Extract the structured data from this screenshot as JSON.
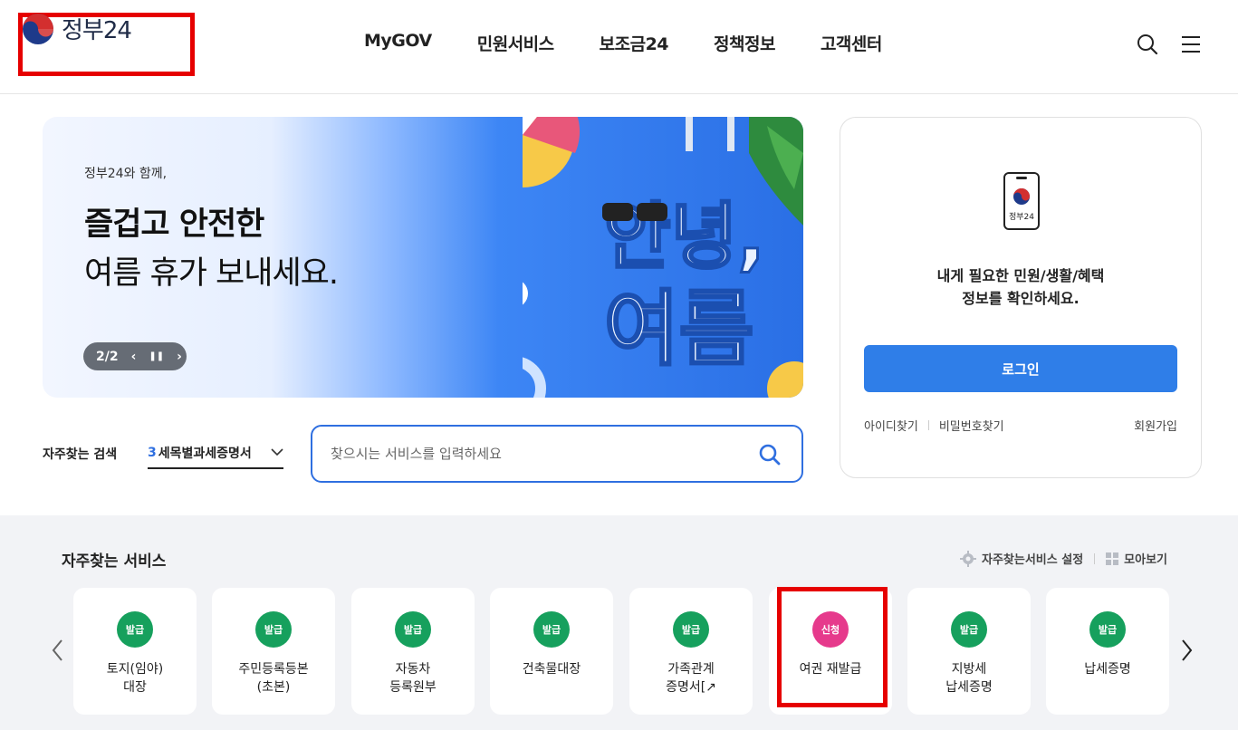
{
  "header": {
    "logo_text": "정부24",
    "nav": [
      "MyGOV",
      "민원서비스",
      "보조금24",
      "정책정보",
      "고객센터"
    ]
  },
  "banner": {
    "small_text": "정부24와 함께,",
    "headline_bold": "즐겁고 안전한",
    "headline_regular": "여름 휴가 보내세요.",
    "pager": "2/2",
    "art_text_1": "안녕,",
    "art_text_2": "여름"
  },
  "login": {
    "phone_label": "정부24",
    "message_line1": "내게 필요한 민원/생활/혜택",
    "message_line2": "정보를 확인하세요.",
    "button": "로그인",
    "find_id": "아이디찾기",
    "find_pw": "비밀번호찾기",
    "join": "회원가입"
  },
  "frequent_search": {
    "label": "자주찾는 검색",
    "selected_num": "3",
    "selected_text": "세목별과세증명서",
    "placeholder": "찾으시는 서비스를 입력하세요"
  },
  "services": {
    "title": "자주찾는 서비스",
    "settings": "자주찾는서비스 설정",
    "view_all": "모아보기",
    "items": [
      {
        "badge": "발급",
        "label": "토지(임야)\n대장"
      },
      {
        "badge": "발급",
        "label": "주민등록등본\n(초본)"
      },
      {
        "badge": "발급",
        "label": "자동차\n등록원부"
      },
      {
        "badge": "발급",
        "label": "건축물대장"
      },
      {
        "badge": "발급",
        "label": "가족관계\n증명서[↗"
      },
      {
        "badge": "신청",
        "label": "여권 재발급"
      },
      {
        "badge": "발급",
        "label": "지방세\n납세증명"
      },
      {
        "badge": "발급",
        "label": "납세증명"
      }
    ]
  }
}
